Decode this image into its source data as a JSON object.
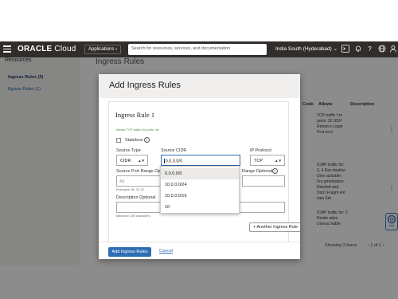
{
  "topbar": {
    "logo_brand": "ORACLE",
    "logo_product": " Cloud",
    "apps_label": "Applications ›",
    "search_placeholder": "Search for resources, services, and documentation",
    "region": "India South (Hyderabad) ⌄"
  },
  "background": {
    "resources_title": "Resources",
    "page_heading": "Ingress Rules",
    "sidebar": [
      {
        "label": "Ingress Rules (3)",
        "active": true
      },
      {
        "label": "Egress Rules (1)",
        "active": false
      }
    ],
    "columns": [
      "Code",
      "Allows",
      "Description"
    ],
    "allows": [
      "TCP traffic f or ports: 22 SSH Remot e Login Prot ocol",
      "ICMP traffic for: 3, 4 Des tination Unre achable: Fra gmentation Needed and Don't Fragm ent was Set",
      "ICMP traffic for: 3 Destin ation Unreac hable"
    ],
    "pager_text": "Showing 3 items",
    "pager_pages": "‹ 1 of 1 ›"
  },
  "modal": {
    "title": "Add Ingress Rules",
    "rule_title": "Ingress Rule 1",
    "rule_note": "Allows TCP traffic for ports: all",
    "stateless_label": "Stateless",
    "source_type_label": "Source Type",
    "source_type_value": "CIDR",
    "source_cidr_label": "Source CIDR",
    "source_cidr_value": "0.0.0.0/0",
    "ip_protocol_label": "IP Protocol",
    "ip_protocol_value": "TCP",
    "source_port_label": "Source Port Range",
    "source_port_optional": "Op",
    "source_port_placeholder": "All",
    "source_port_hint": "Examples: 80, 20-22",
    "dest_port_label": "Range",
    "dest_port_optional": "Optional",
    "description_label": "Description",
    "description_optional": "Optional",
    "description_hint": "Maximum 255 characters",
    "cidr_suggestions": [
      "0.0.0.0/0",
      "10.0.0.0/24",
      "10.0.0.0/16",
      "10"
    ],
    "another_rule_label": "+ Another Ingress Rule",
    "submit_label": "Add Ingress Rules",
    "cancel_label": "Cancel"
  },
  "icons": {
    "menu": "hamburger-icon",
    "shell": "cloud-shell-icon",
    "bell": "bell-icon",
    "help": "help-icon",
    "globe": "globe-icon",
    "profile": "profile-icon"
  },
  "colors": {
    "primary": "#2e6eb4",
    "topbar": "#312d2a"
  }
}
